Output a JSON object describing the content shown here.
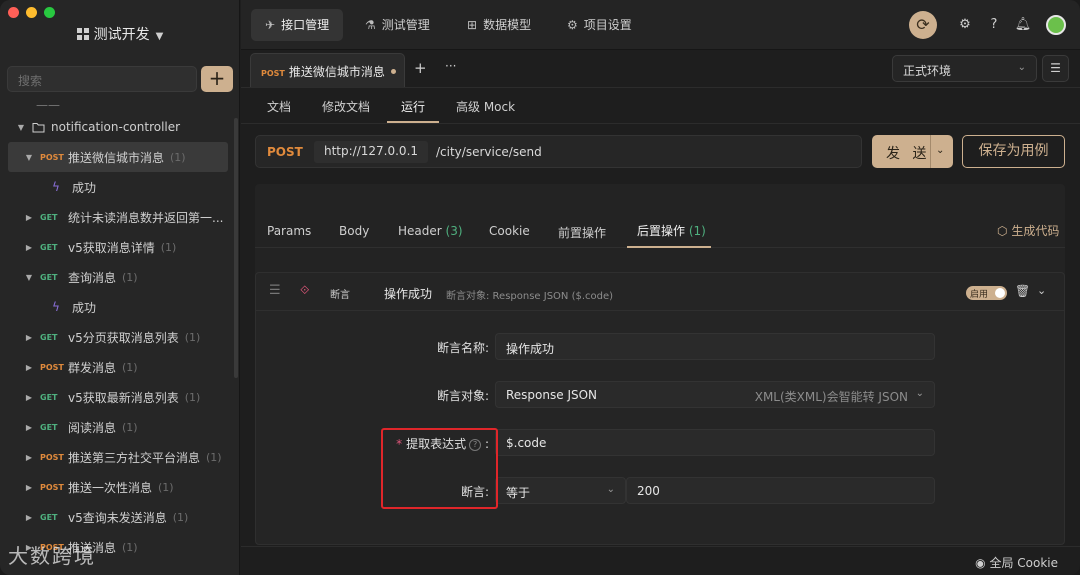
{
  "sidebar": {
    "project_name": "测试开发",
    "search_placeholder": "搜索",
    "add_label": "+",
    "partial_row": "——",
    "folder": "notification-controller",
    "items": [
      {
        "method": "POST",
        "label": "推送微信城市消息",
        "count": "(1)"
      },
      {
        "label": "成功"
      },
      {
        "method": "GET",
        "label": "统计未读消息数并返回第一..."
      },
      {
        "method": "GET",
        "label": "v5获取消息详情",
        "count": "(1)"
      },
      {
        "method": "GET",
        "label": "查询消息",
        "count": "(1)"
      },
      {
        "label": "成功"
      },
      {
        "method": "GET",
        "label": "v5分页获取消息列表",
        "count": "(1)"
      },
      {
        "method": "POST",
        "label": "群发消息",
        "count": "(1)"
      },
      {
        "method": "GET",
        "label": "v5获取最新消息列表",
        "count": "(1)"
      },
      {
        "method": "GET",
        "label": "阅读消息",
        "count": "(1)"
      },
      {
        "method": "POST",
        "label": "推送第三方社交平台消息",
        "count": "(1)"
      },
      {
        "method": "POST",
        "label": "推送一次性消息",
        "count": "(1)"
      },
      {
        "method": "GET",
        "label": "v5查询未发送消息",
        "count": "(1)"
      },
      {
        "method": "POST",
        "label": "推送消息",
        "count": "(1)"
      }
    ],
    "watermark": "大数跨境"
  },
  "topnav": {
    "tabs": [
      "接口管理",
      "测试管理",
      "数据模型",
      "项目设置"
    ]
  },
  "request_tab": {
    "method": "POST",
    "title": "推送微信城市消息",
    "add": "+",
    "more": "···"
  },
  "environment": {
    "selected": "正式环境"
  },
  "subtabs": [
    "文档",
    "修改文档",
    "运行",
    "高级 Mock"
  ],
  "url": {
    "method": "POST",
    "host": "http://127.0.0.1",
    "path": "/city/service/send"
  },
  "buttons": {
    "send": "发 送",
    "save": "保存为用例",
    "gen_code": "生成代码"
  },
  "param_tabs": [
    {
      "label": "Params"
    },
    {
      "label": "Body"
    },
    {
      "label": "Header",
      "count": "(3)"
    },
    {
      "label": "Cookie"
    },
    {
      "label": "前置操作"
    },
    {
      "label": "后置操作",
      "count": "(1)"
    }
  ],
  "assertion": {
    "type": "断言",
    "name": "操作成功",
    "desc": "断言对象: Response JSON ($.code)",
    "enabled_label": "启用",
    "form": {
      "name_label": "断言名称:",
      "name_value": "操作成功",
      "target_label": "断言对象:",
      "target_value": "Response JSON",
      "target_hint": "XML(类XML)会智能转 JSON",
      "expr_label": "提取表达式",
      "expr_colon": ":",
      "expr_value": "$.code",
      "assert_label": "断言:",
      "operator": "等于",
      "expected": "200"
    }
  },
  "footer": {
    "cookie": "全局 Cookie"
  },
  "colors": {
    "accent": "#cdb08f",
    "post": "#e08a3c",
    "get": "#4fb07f",
    "highlight": "#e0262a"
  }
}
